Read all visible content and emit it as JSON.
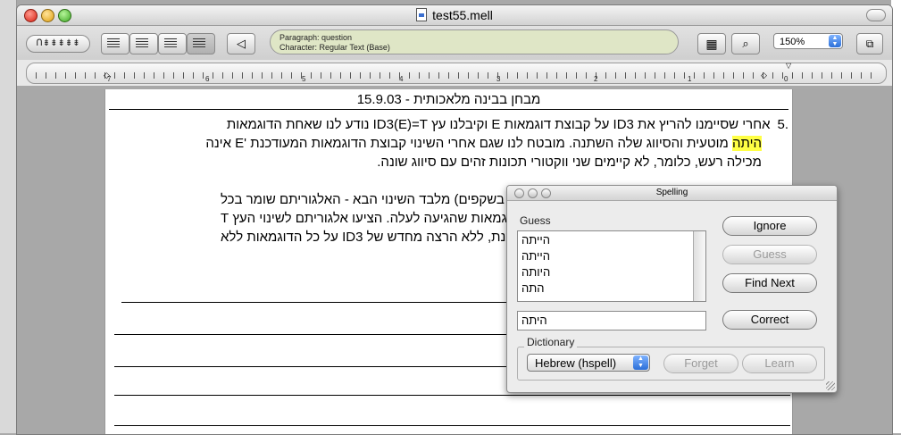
{
  "window": {
    "title": "test55.mell"
  },
  "toolbar": {
    "style_button": "ꓵ⇟⇟⇟⇟⇟",
    "paragraph_status": "Paragraph: question",
    "character_status": "Character: Regular Text (Base)",
    "zoom": "150%"
  },
  "ruler": {
    "numbers": [
      "7",
      "6",
      "5",
      "4",
      "3",
      "2",
      "1",
      "0"
    ]
  },
  "document": {
    "header": "מבחן בבינה מלאכותית - 15.9.03",
    "q5_number": ".5",
    "q5_line1": "אחרי שסיימנו להריץ את ID3 על קבוצת דוגמאות E וקיבלנו עץ ID3(E)=T נודע לנו שאחת הדוגמאות",
    "q5_highlight": "היתה",
    "q5_line2_rest": " מוטעית והסיווג שלה השתנה.  מובטח לנו שגם אחרי השינוי קבוצת הדוגמאות המעודכנת 'E אינה",
    "q5_line3": "מכילה רעש, כלומר, לא קיימים שני ווקטורי תכונות זהים עם סיווג שונה.",
    "p2_line1": "שהופיעה בשקפים) מלבד השינוי הבא - האלגוריתם שומר בכל",
    "p2_line2": "צת הדוגמאות שהגיעה לעלה.  הציעו אלגוריתם לשינוי העץ T",
    "p2_line3": "ת המעודכנת, ללא הרצה מחדש של ID3 על כל הדוגמאות ללא"
  },
  "spelling": {
    "title": "Spelling",
    "guess_label": "Guess",
    "guesses": [
      "הייתה",
      "הייתה",
      "היותה",
      "התה"
    ],
    "word": "היתה",
    "buttons": {
      "ignore": "Ignore",
      "guess": "Guess",
      "find_next": "Find Next",
      "correct": "Correct"
    },
    "dictionary_label": "Dictionary",
    "dictionary": "Hebrew (hspell)",
    "forget": "Forget",
    "learn": "Learn"
  }
}
